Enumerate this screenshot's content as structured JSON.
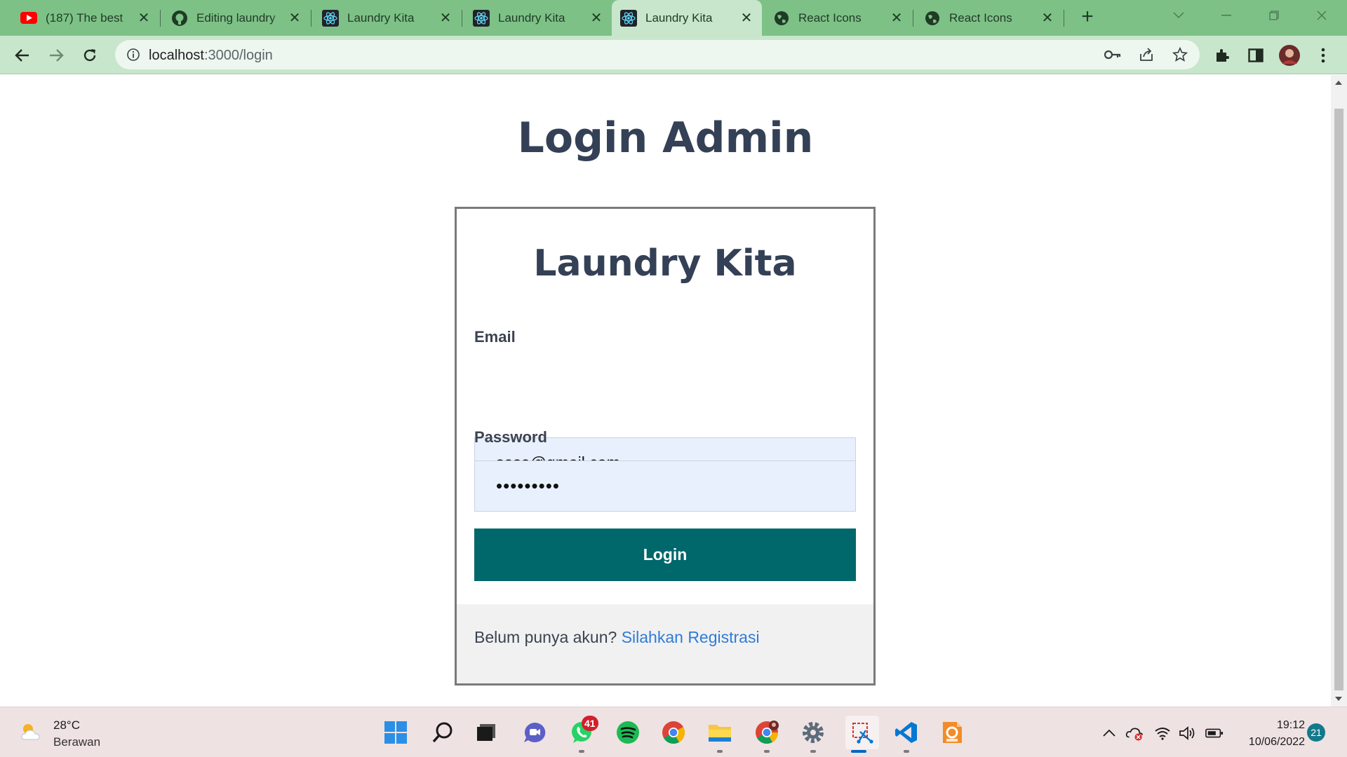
{
  "browser": {
    "tabs": [
      {
        "title": "(187) The best",
        "icon": "youtube-icon",
        "active": false
      },
      {
        "title": "Editing laundry",
        "icon": "github-icon",
        "active": false
      },
      {
        "title": "Laundry Kita",
        "icon": "react-icon",
        "active": false
      },
      {
        "title": "Laundry Kita",
        "icon": "react-icon",
        "active": false
      },
      {
        "title": "Laundry Kita",
        "icon": "react-icon",
        "active": true
      },
      {
        "title": "React Icons",
        "icon": "globe-icon",
        "active": false
      },
      {
        "title": "React Icons",
        "icon": "globe-icon",
        "active": false
      }
    ],
    "close_glyph": "✕",
    "new_tab_glyph": "+",
    "address": {
      "host": "localhost",
      "path": ":3000/login"
    }
  },
  "page": {
    "title": "Login Admin",
    "card_title": "Laundry Kita",
    "email_label": "Email",
    "email_value": "sasa@gmail.com",
    "password_label": "Password",
    "password_value": "•••••••••",
    "login_button": "Login",
    "footer_text": "Belum punya akun? ",
    "footer_link": "Silahkan Registrasi"
  },
  "taskbar": {
    "weather_temp": "28°C",
    "weather_desc": "Berawan",
    "whatsapp_badge": "41",
    "time": "19:12",
    "date": "10/06/2022",
    "notifications": "21"
  },
  "colors": {
    "tabstrip": "#7dc187",
    "toolbar": "#c8e6cb",
    "heading": "#344055",
    "button": "#00676a",
    "link": "#2f7bd6",
    "input_bg": "#e8f0fe"
  }
}
